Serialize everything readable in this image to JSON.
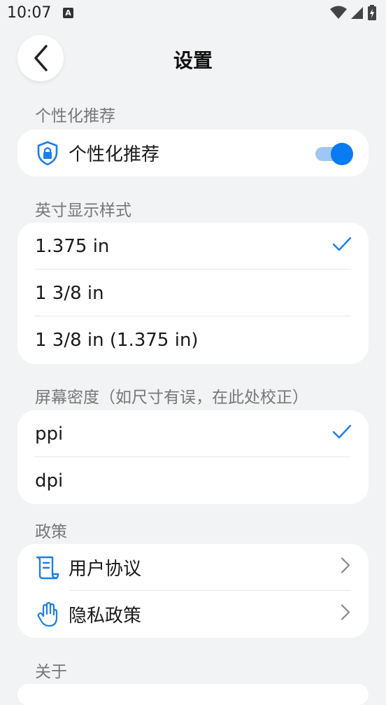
{
  "status": {
    "time": "10:07",
    "a_icon": "A"
  },
  "header": {
    "title": "设置"
  },
  "sections": {
    "personalization": {
      "label": "个性化推荐",
      "toggle_label": "个性化推荐",
      "toggle_on": true
    },
    "inch": {
      "label": "英寸显示样式",
      "options": [
        "1.375 in",
        "1 3/8 in",
        "1 3/8 in (1.375 in)"
      ],
      "selected_index": 0
    },
    "density": {
      "label": "屏幕密度（如尺寸有误，在此处校正）",
      "options": [
        "ppi",
        "dpi"
      ],
      "selected_index": 0
    },
    "policy": {
      "label": "政策",
      "items": [
        "用户协议",
        "隐私政策"
      ]
    },
    "about": {
      "label": "关于"
    }
  },
  "colors": {
    "accent": "#0a7cf2",
    "background": "#f2f3f5",
    "card": "#ffffff"
  },
  "icons": [
    "back-arrow-icon",
    "shield-lock-icon",
    "checkmark-icon",
    "scroll-document-icon",
    "hand-icon",
    "chevron-right-icon"
  ]
}
